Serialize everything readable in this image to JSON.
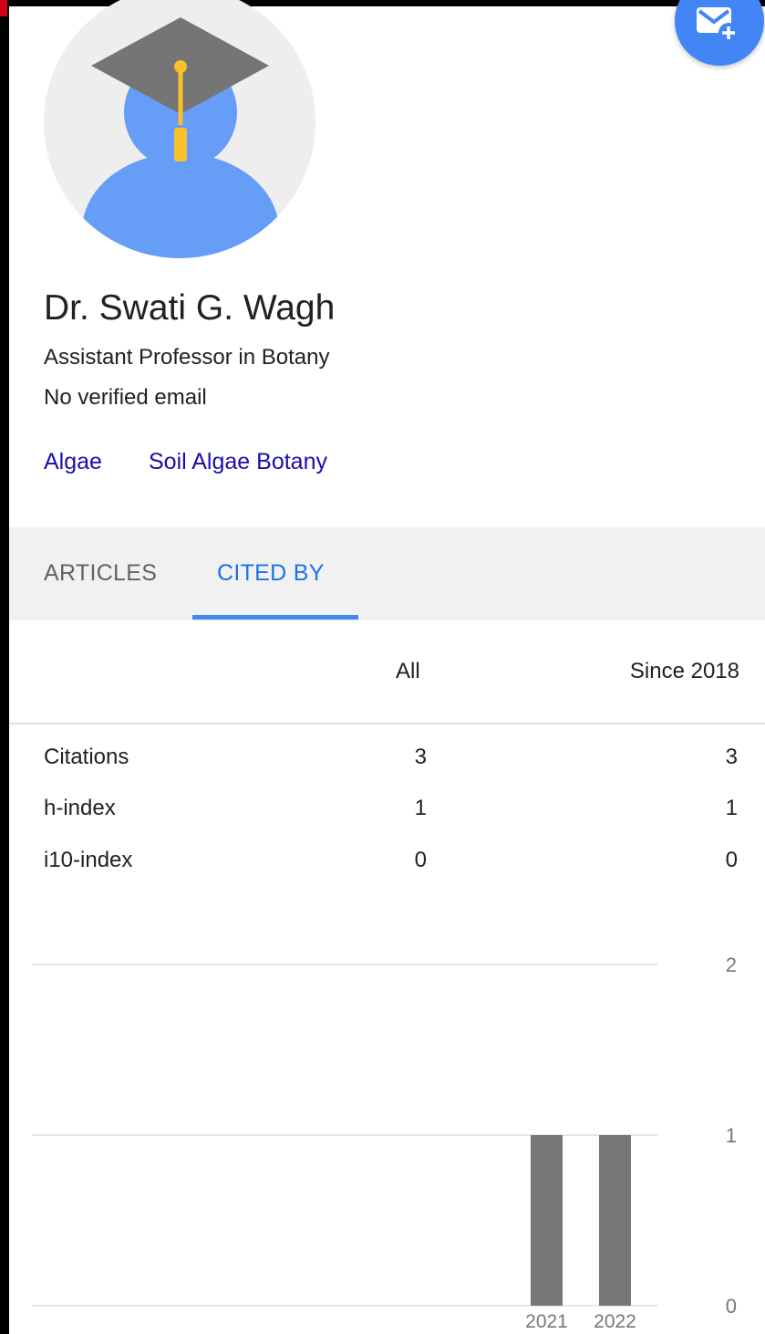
{
  "profile": {
    "name": "Dr. Swati G. Wagh",
    "affiliation": "Assistant Professor in Botany",
    "email_status": "No verified email",
    "interests": [
      "Algae",
      "Soil Algae Botany"
    ],
    "avatar_icon": "graduate-avatar-icon"
  },
  "fab": {
    "icon": "mail-plus-icon",
    "color": "#4285f4"
  },
  "tabs": [
    {
      "label": "ARTICLES",
      "active": false
    },
    {
      "label": "CITED BY",
      "active": true
    }
  ],
  "stats": {
    "columns": {
      "all": "All",
      "since": "Since 2018"
    },
    "rows": [
      {
        "label": "Citations",
        "all": "3",
        "since": "3"
      },
      {
        "label": "h-index",
        "all": "1",
        "since": "1"
      },
      {
        "label": "i10-index",
        "all": "0",
        "since": "0"
      }
    ]
  },
  "chart_data": {
    "type": "bar",
    "categories": [
      "2021",
      "2022"
    ],
    "values": [
      1,
      1
    ],
    "ylim": [
      0,
      2
    ],
    "yticks": [
      0,
      1,
      2
    ],
    "y_axis_side": "right",
    "grid": true,
    "bar_color": "#777777"
  },
  "colors": {
    "accent": "#1a73e8",
    "link": "#1a0dab",
    "tab_bar": "#f1f1f1"
  }
}
